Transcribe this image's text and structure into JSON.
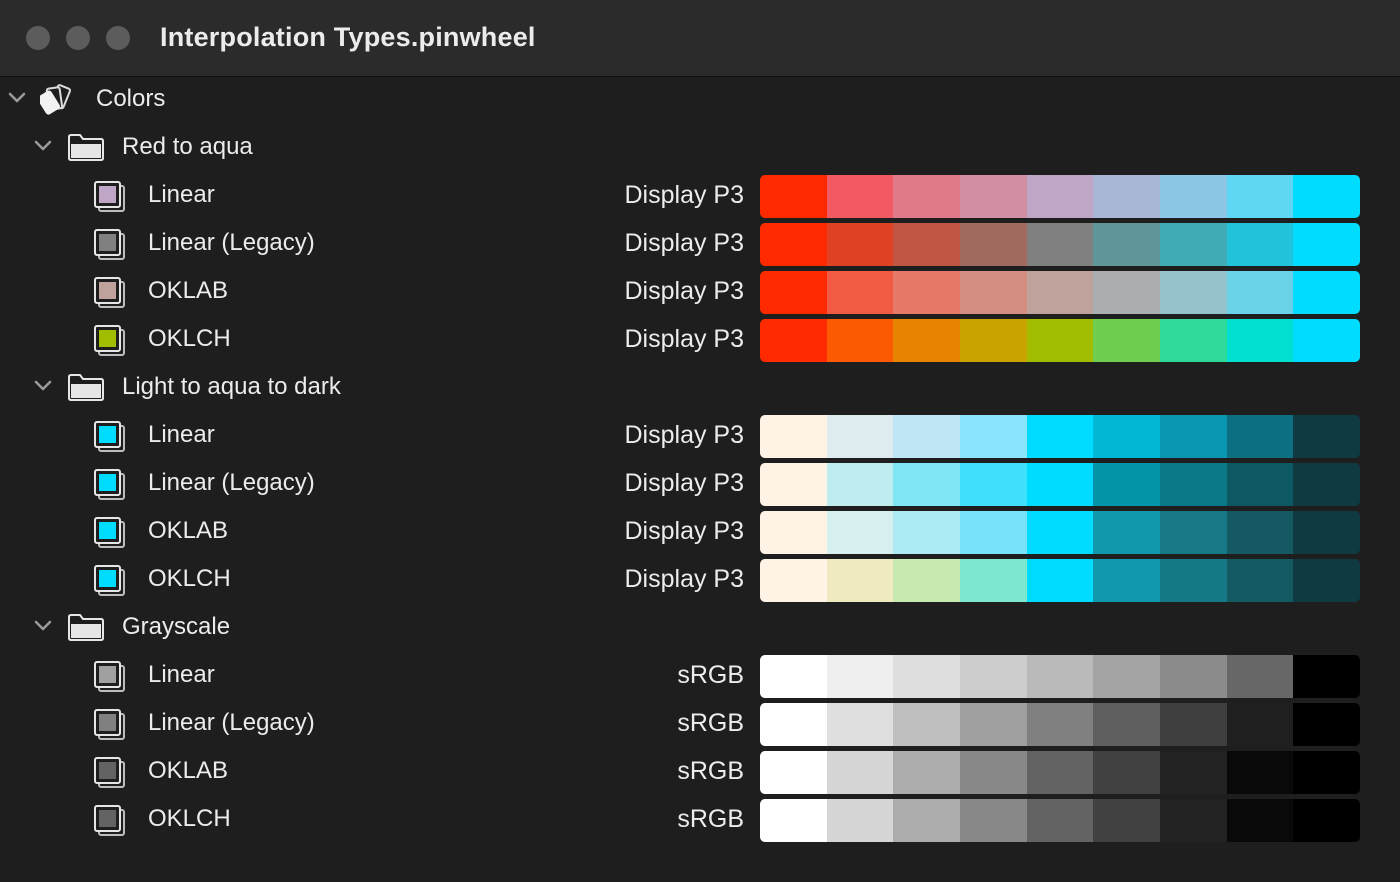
{
  "window": {
    "title": "Interpolation Types.pinwheel"
  },
  "root": {
    "label": "Colors"
  },
  "groups": [
    {
      "label": "Red to aqua",
      "items": [
        {
          "label": "Linear",
          "space": "Display P3",
          "swatch": "#bfa6c6",
          "colors": [
            "#ff2a00",
            "#f25a63",
            "#e07a8a",
            "#d08fa3",
            "#bfa6c6",
            "#a9b6d6",
            "#8ec6e6",
            "#5fd6f3",
            "#00dcff"
          ]
        },
        {
          "label": "Linear (Legacy)",
          "space": "Display P3",
          "swatch": "#808080",
          "colors": [
            "#ff2a00",
            "#df4124",
            "#c05544",
            "#a06a5f",
            "#808080",
            "#5f9699",
            "#40abb5",
            "#20c3da",
            "#00dcff"
          ]
        },
        {
          "label": "OKLAB",
          "space": "Display P3",
          "swatch": "#c0a29d",
          "colors": [
            "#ff2a00",
            "#f25b43",
            "#e67a66",
            "#d48f82",
            "#c0a29d",
            "#abaeae",
            "#93c2cc",
            "#6bd1e6",
            "#00dcff"
          ]
        },
        {
          "label": "OKLCH",
          "space": "Display P3",
          "swatch": "#a2bc00",
          "colors": [
            "#ff2a00",
            "#fb5a00",
            "#e68400",
            "#c9a400",
            "#a2bc00",
            "#6fcd4f",
            "#2fd99a",
            "#00dfd0",
            "#00dcff"
          ]
        }
      ]
    },
    {
      "label": "Light to aqua to dark",
      "items": [
        {
          "label": "Linear",
          "space": "Display P3",
          "swatch": "#00dcff",
          "colors": [
            "#fff3e6",
            "#dfecef",
            "#bfe6f5",
            "#8ae4fb",
            "#00dcff",
            "#00b7d6",
            "#0896b1",
            "#0c6f82",
            "#0f3a42"
          ]
        },
        {
          "label": "Linear (Legacy)",
          "space": "Display P3",
          "swatch": "#00dcff",
          "colors": [
            "#fff3e6",
            "#bfecef",
            "#80e6f5",
            "#3fe0fb",
            "#00dcff",
            "#0495ab",
            "#0b7888",
            "#0c5863",
            "#0f3a42"
          ]
        },
        {
          "label": "OKLAB",
          "space": "Display P3",
          "swatch": "#00dcff",
          "colors": [
            "#fff3e6",
            "#d5f0ef",
            "#aeeaf3",
            "#78e2fb",
            "#00dcff",
            "#1298ad",
            "#177886",
            "#155a63",
            "#0f3a42"
          ]
        },
        {
          "label": "OKLCH",
          "space": "Display P3",
          "swatch": "#00dcff",
          "colors": [
            "#fff3e6",
            "#f0eac0",
            "#c6eab0",
            "#7ee8cf",
            "#00dcff",
            "#1198af",
            "#157886",
            "#145a63",
            "#0f3a42"
          ]
        }
      ]
    },
    {
      "label": "Grayscale",
      "items": [
        {
          "label": "Linear",
          "space": "sRGB",
          "swatch": "#a0a0a0",
          "colors": [
            "#ffffff",
            "#efefef",
            "#dedede",
            "#cdcdcd",
            "#bababa",
            "#a4a4a4",
            "#8b8b8b",
            "#676767",
            "#000000"
          ]
        },
        {
          "label": "Linear (Legacy)",
          "space": "sRGB",
          "swatch": "#808080",
          "colors": [
            "#ffffff",
            "#dfdfdf",
            "#bfbfbf",
            "#9f9f9f",
            "#808080",
            "#5f5f5f",
            "#3f3f3f",
            "#1f1f1f",
            "#000000"
          ]
        },
        {
          "label": "OKLAB",
          "space": "sRGB",
          "swatch": "#636363",
          "colors": [
            "#ffffff",
            "#d6d6d6",
            "#adadad",
            "#888888",
            "#636363",
            "#414141",
            "#222222",
            "#090909",
            "#000000"
          ]
        },
        {
          "label": "OKLCH",
          "space": "sRGB",
          "swatch": "#636363",
          "colors": [
            "#ffffff",
            "#d6d6d6",
            "#adadad",
            "#888888",
            "#636363",
            "#414141",
            "#222222",
            "#090909",
            "#000000"
          ]
        }
      ]
    }
  ]
}
